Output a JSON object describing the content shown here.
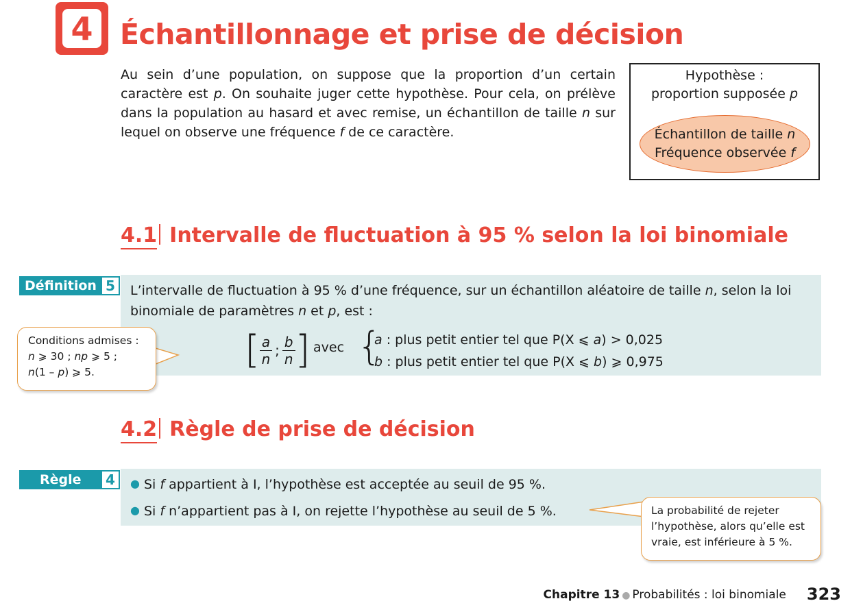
{
  "section": {
    "number": "4",
    "title": "Échantillonnage et prise de décision"
  },
  "intro": {
    "part1": "Au sein d’une population, on suppose que la proportion d’un certain caractère est ",
    "var_p": "p",
    "part2": ". On souhaite juger cette hypothèse. Pour cela, on prélève dans la population au hasard et avec remise, un échantillon de taille ",
    "var_n": "n",
    "part3": " sur lequel on observe une fréquence ",
    "var_f": "f",
    "part4": " de ce caractère."
  },
  "hypothesis_box": {
    "line1": "Hypothèse :",
    "line2_text": "proportion supposée ",
    "line2_var": "p",
    "ellipse_line1_text": "Échantillon de taille ",
    "ellipse_line1_var": "n",
    "ellipse_line2_text": "Fréquence observée ",
    "ellipse_line2_var": "f"
  },
  "subsection1": {
    "number": "4.1",
    "title": "Intervalle de fluctuation à 95 % selon la loi binomiale"
  },
  "definition": {
    "tag_label": "Définition",
    "tag_number": "5",
    "text_part1": "L’intervalle de fluctuation à 95 % d’une fréquence, sur un échantillon aléatoire de taille ",
    "text_var_n": "n",
    "text_part2": ", selon la loi binomiale de paramètres ",
    "text_var_n2": "n",
    "text_part3": " et ",
    "text_var_p": "p",
    "text_part4": ", est :",
    "frac_a_num": "a",
    "frac_a_den": "n",
    "frac_sep": ";",
    "frac_b_num": "b",
    "frac_b_den": "n",
    "avec": "avec",
    "cond_a_var": "a",
    "cond_a_text1": " : plus petit entier tel que P(X ⩽ ",
    "cond_a_var2": "a",
    "cond_a_text2": ") > 0,025",
    "cond_b_var": "b",
    "cond_b_text1": " : plus petit entier tel que P(X ⩽ ",
    "cond_b_var2": "b",
    "cond_b_text2": ") ⩾ 0,975"
  },
  "conditions_callout": {
    "line1": "Conditions admises :",
    "line2_n": "n",
    "line2_a": " ⩾ 30 ; ",
    "line2_np": "np",
    "line2_b": " ⩾ 5 ;",
    "line3_n": "n",
    "line3_a": "(1 – ",
    "line3_p": "p",
    "line3_b": ") ⩾ 5."
  },
  "subsection2": {
    "number": "4.2",
    "title": "Règle de prise de décision"
  },
  "rule": {
    "tag_label": "Règle",
    "tag_number": "4",
    "line1_a": "Si ",
    "line1_f": "f",
    "line1_b": " appartient à I, l’hypothèse est acceptée au seuil de 95 %.",
    "line2_a": "Si ",
    "line2_f": "f",
    "line2_b": " n’appartient pas à I, on rejette l’hypothèse au seuil de 5 %."
  },
  "rule_callout": {
    "line1": "La probabilité de rejeter",
    "line2": "l’hypothèse, alors qu’elle est",
    "line3": "vraie, est inférieure à 5 %."
  },
  "footer": {
    "chapter": "Chapitre 13",
    "subject": "Probabilités : loi binomiale",
    "page": "323"
  },
  "colors": {
    "accent_red": "#e8473b",
    "teal": "#1b9aaa",
    "band": "#deecec",
    "ellipse_fill": "#f8c8a9",
    "callout_border": "#e8a04b"
  }
}
